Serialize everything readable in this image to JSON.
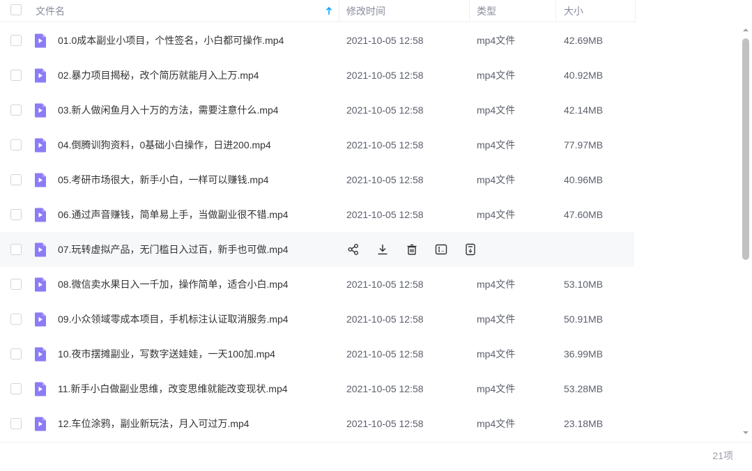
{
  "header": {
    "name_col": "文件名",
    "time_col": "修改时间",
    "type_col": "类型",
    "size_col": "大小",
    "sort_icon": "arrow-up-icon"
  },
  "files": [
    {
      "name": "01.0成本副业小项目，个性签名，小白都可操作.mp4",
      "time": "2021-10-05 12:58",
      "type": "mp4文件",
      "size": "42.69MB"
    },
    {
      "name": "02.暴力项目揭秘，改个简历就能月入上万.mp4",
      "time": "2021-10-05 12:58",
      "type": "mp4文件",
      "size": "40.92MB"
    },
    {
      "name": "03.新人做闲鱼月入十万的方法，需要注意什么.mp4",
      "time": "2021-10-05 12:58",
      "type": "mp4文件",
      "size": "42.14MB"
    },
    {
      "name": "04.倒腾训狗资料，0基础小白操作，日进200.mp4",
      "time": "2021-10-05 12:58",
      "type": "mp4文件",
      "size": "77.97MB"
    },
    {
      "name": "05.考研市场很大，新手小白，一样可以赚钱.mp4",
      "time": "2021-10-05 12:58",
      "type": "mp4文件",
      "size": "40.96MB"
    },
    {
      "name": "06.通过声音赚钱，简单易上手，当做副业很不错.mp4",
      "time": "2021-10-05 12:58",
      "type": "mp4文件",
      "size": "47.60MB"
    },
    {
      "name": "07.玩转虚拟产品，无门槛日入过百，新手也可做.mp4"
    },
    {
      "name": "08.微信卖水果日入一千加，操作简单，适合小白.mp4",
      "time": "2021-10-05 12:58",
      "type": "mp4文件",
      "size": "53.10MB"
    },
    {
      "name": "09.小众领域零成本项目，手机标注认证取消服务.mp4",
      "time": "2021-10-05 12:58",
      "type": "mp4文件",
      "size": "50.91MB"
    },
    {
      "name": "10.夜市摆摊副业，写数字送娃娃，一天100加.mp4",
      "time": "2021-10-05 12:58",
      "type": "mp4文件",
      "size": "36.99MB"
    },
    {
      "name": "11.新手小白做副业思维，改变思维就能改变现状.mp4",
      "time": "2021-10-05 12:58",
      "type": "mp4文件",
      "size": "53.28MB"
    },
    {
      "name": "12.车位涂鸦，副业新玩法，月入可过万.mp4",
      "time": "2021-10-05 12:58",
      "type": "mp4文件",
      "size": "23.18MB"
    }
  ],
  "hover_actions": [
    "share-icon",
    "download-icon",
    "delete-icon",
    "rename-icon",
    "more-icon"
  ],
  "footer": {
    "count": "21项"
  },
  "colors": {
    "accent": "#06a7ff",
    "file_icon": "#8b7cf6",
    "hover_row": "#f7f8fa"
  }
}
